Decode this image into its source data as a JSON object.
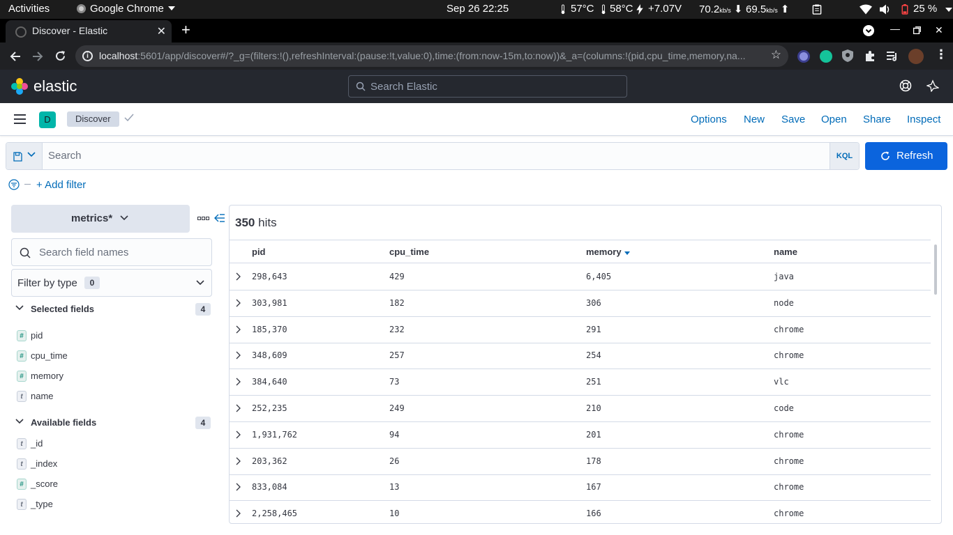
{
  "system_bar": {
    "activities": "Activities",
    "app_name": "Google Chrome",
    "clock": "Sep 26  22:25",
    "temp1": "57°C",
    "temp2": "58°C",
    "voltage": "+7.07V",
    "net_down": "70.2",
    "net_down_unit": "kb/s",
    "net_up": "69.5",
    "net_up_unit": "kb/s",
    "battery": "25 %"
  },
  "browser": {
    "tab_title": "Discover - Elastic",
    "url_host": "localhost",
    "url_rest": ":5601/app/discover#/?_g=(filters:!(),refreshInterval:(pause:!t,value:0),time:(from:now-15m,to:now))&_a=(columns:!(pid,cpu_time,memory,na..."
  },
  "header": {
    "logo_text": "elastic",
    "search_placeholder": "Search Elastic"
  },
  "appbar": {
    "space_initial": "D",
    "breadcrumb": "Discover",
    "nav": [
      "Options",
      "New",
      "Save",
      "Open",
      "Share",
      "Inspect"
    ]
  },
  "query": {
    "placeholder": "Search",
    "language": "KQL",
    "refresh_label": "Refresh",
    "add_filter": "+ Add filter"
  },
  "sidebar": {
    "index_pattern": "metrics*",
    "field_search_placeholder": "Search field names",
    "filter_by_type": "Filter by type",
    "filter_count": "0",
    "selected_title": "Selected fields",
    "selected_count": "4",
    "selected_fields": [
      {
        "type": "#",
        "name": "pid"
      },
      {
        "type": "#",
        "name": "cpu_time"
      },
      {
        "type": "#",
        "name": "memory"
      },
      {
        "type": "t",
        "name": "name"
      }
    ],
    "available_title": "Available fields",
    "available_count": "4",
    "available_fields": [
      {
        "type": "t",
        "name": "_id"
      },
      {
        "type": "t",
        "name": "_index"
      },
      {
        "type": "#",
        "name": "_score"
      },
      {
        "type": "t",
        "name": "_type"
      }
    ]
  },
  "results": {
    "hits_count": "350",
    "hits_label": "hits",
    "columns": [
      "pid",
      "cpu_time",
      "memory",
      "name"
    ],
    "sorted_column": "memory",
    "rows": [
      {
        "pid": "298,643",
        "cpu_time": "429",
        "memory": "6,405",
        "name": "java"
      },
      {
        "pid": "303,981",
        "cpu_time": "182",
        "memory": "306",
        "name": "node"
      },
      {
        "pid": "185,370",
        "cpu_time": "232",
        "memory": "291",
        "name": "chrome"
      },
      {
        "pid": "348,609",
        "cpu_time": "257",
        "memory": "254",
        "name": "chrome"
      },
      {
        "pid": "384,640",
        "cpu_time": "73",
        "memory": "251",
        "name": "vlc"
      },
      {
        "pid": "252,235",
        "cpu_time": "249",
        "memory": "210",
        "name": "code"
      },
      {
        "pid": "1,931,762",
        "cpu_time": "94",
        "memory": "201",
        "name": "chrome"
      },
      {
        "pid": "203,362",
        "cpu_time": "26",
        "memory": "178",
        "name": "chrome"
      },
      {
        "pid": "833,084",
        "cpu_time": "13",
        "memory": "167",
        "name": "chrome"
      },
      {
        "pid": "2,258,465",
        "cpu_time": "10",
        "memory": "166",
        "name": "chrome"
      }
    ]
  },
  "colors": {
    "primary": "#0b64dd",
    "link": "#006bb8",
    "header_bg": "#25282f",
    "space_badge": "#01b5a9"
  }
}
